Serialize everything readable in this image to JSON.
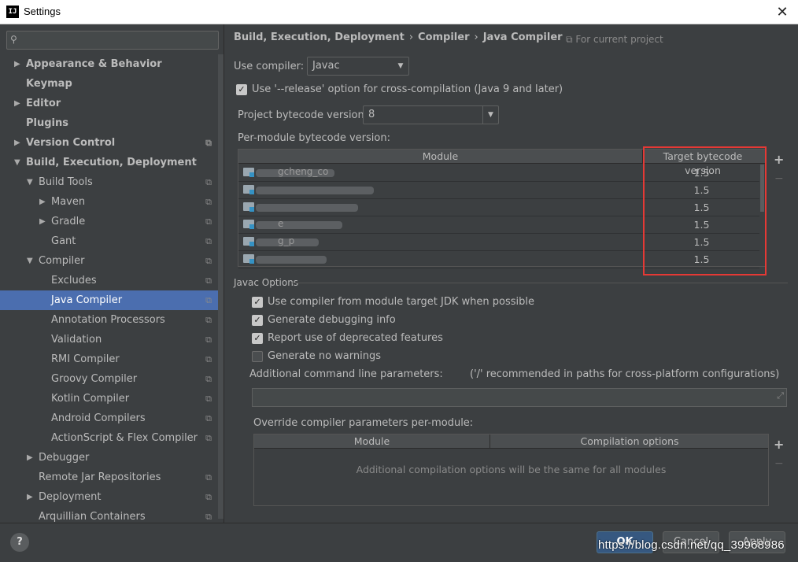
{
  "window": {
    "title": "Settings",
    "icon_name": "intellij-icon",
    "close_glyph": "✕"
  },
  "sidebar": {
    "search_icon": "⚲",
    "items": [
      {
        "label": "Appearance & Behavior",
        "arrow": "▶",
        "bold": true,
        "level": 0,
        "project": false
      },
      {
        "label": "Keymap",
        "arrow": "",
        "bold": true,
        "level": 0,
        "project": false
      },
      {
        "label": "Editor",
        "arrow": "▶",
        "bold": true,
        "level": 0,
        "project": false
      },
      {
        "label": "Plugins",
        "arrow": "",
        "bold": true,
        "level": 0,
        "project": false
      },
      {
        "label": "Version Control",
        "arrow": "▶",
        "bold": true,
        "level": 0,
        "project": true
      },
      {
        "label": "Build, Execution, Deployment",
        "arrow": "▼",
        "bold": true,
        "level": 0,
        "project": false
      },
      {
        "label": "Build Tools",
        "arrow": "▼",
        "bold": false,
        "level": 1,
        "project": true
      },
      {
        "label": "Maven",
        "arrow": "▶",
        "bold": false,
        "level": 2,
        "project": true
      },
      {
        "label": "Gradle",
        "arrow": "▶",
        "bold": false,
        "level": 2,
        "project": true
      },
      {
        "label": "Gant",
        "arrow": "",
        "bold": false,
        "level": 2,
        "project": true
      },
      {
        "label": "Compiler",
        "arrow": "▼",
        "bold": false,
        "level": 1,
        "project": true
      },
      {
        "label": "Excludes",
        "arrow": "",
        "bold": false,
        "level": 2,
        "project": true
      },
      {
        "label": "Java Compiler",
        "arrow": "",
        "bold": false,
        "level": 2,
        "project": true,
        "selected": true
      },
      {
        "label": "Annotation Processors",
        "arrow": "",
        "bold": false,
        "level": 2,
        "project": true
      },
      {
        "label": "Validation",
        "arrow": "",
        "bold": false,
        "level": 2,
        "project": true
      },
      {
        "label": "RMI Compiler",
        "arrow": "",
        "bold": false,
        "level": 2,
        "project": true
      },
      {
        "label": "Groovy Compiler",
        "arrow": "",
        "bold": false,
        "level": 2,
        "project": true
      },
      {
        "label": "Kotlin Compiler",
        "arrow": "",
        "bold": false,
        "level": 2,
        "project": true
      },
      {
        "label": "Android Compilers",
        "arrow": "",
        "bold": false,
        "level": 2,
        "project": true
      },
      {
        "label": "ActionScript & Flex Compiler",
        "arrow": "",
        "bold": false,
        "level": 2,
        "project": true
      },
      {
        "label": "Debugger",
        "arrow": "▶",
        "bold": false,
        "level": 1,
        "project": false
      },
      {
        "label": "Remote Jar Repositories",
        "arrow": "",
        "bold": false,
        "level": 1,
        "project": true
      },
      {
        "label": "Deployment",
        "arrow": "▶",
        "bold": false,
        "level": 1,
        "project": true
      },
      {
        "label": "Arquillian Containers",
        "arrow": "",
        "bold": false,
        "level": 1,
        "project": true
      }
    ],
    "project_icon": "⧉"
  },
  "breadcrumb": {
    "parts": [
      "Build, Execution, Deployment",
      "Compiler",
      "Java Compiler"
    ],
    "separator": "›",
    "for_project": "For current project",
    "for_project_icon": "⧉"
  },
  "compiler": {
    "use_compiler_label": "Use compiler:",
    "use_compiler_value": "Javac",
    "release_option_label": "Use '--release' option for cross-compilation (Java 9 and later)",
    "release_option_checked": true,
    "project_bytecode_label": "Project bytecode version:",
    "project_bytecode_value": "8",
    "per_module_label": "Per-module bytecode version:",
    "module_table": {
      "headers": [
        "Module",
        "Target bytecode version"
      ],
      "rows": [
        {
          "module": "gcheng_co",
          "version": "1.5"
        },
        {
          "module": "",
          "version": "1.5"
        },
        {
          "module": "",
          "version": "1.5"
        },
        {
          "module": "e",
          "version": "1.5"
        },
        {
          "module": "g_p",
          "version": "1.5"
        },
        {
          "module": "",
          "version": "1.5"
        }
      ]
    }
  },
  "javac": {
    "section_title": "Javac Options",
    "options": [
      {
        "label": "Use compiler from module target JDK when possible",
        "checked": true
      },
      {
        "label": "Generate debugging info",
        "checked": true
      },
      {
        "label": "Report use of deprecated features",
        "checked": true
      },
      {
        "label": "Generate no warnings",
        "checked": false
      }
    ],
    "additional_params_label": "Additional command line parameters:",
    "additional_params_hint": "('/' recommended in paths for cross-platform configurations)",
    "additional_params_value": "",
    "override_label": "Override compiler parameters per-module:",
    "override_table": {
      "headers": [
        "Module",
        "Compilation options"
      ],
      "empty_text": "Additional compilation options will be the same for all modules"
    }
  },
  "footer": {
    "help": "?",
    "ok": "OK",
    "cancel": "Cancel",
    "apply": "Apply",
    "watermark": "https://blog.csdn.net/qq_39968986"
  },
  "table_controls": {
    "add": "+",
    "remove": "−"
  },
  "colors": {
    "selection": "#4b6eaf",
    "highlight_box": "#e53935",
    "ok_button": "#365880"
  }
}
